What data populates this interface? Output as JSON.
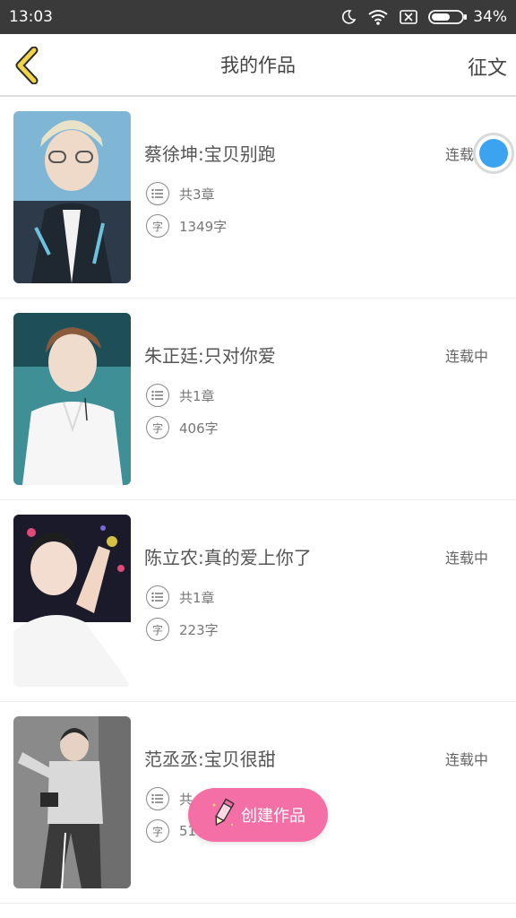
{
  "status_bar": {
    "time": "13:03",
    "battery": "34%"
  },
  "header": {
    "title": "我的作品",
    "action_label": "征文"
  },
  "works": [
    {
      "title": "蔡徐坤:宝贝别跑",
      "status": "连载中",
      "chapters": "共3章",
      "words": "1349字"
    },
    {
      "title": "朱正廷:只对你爱",
      "status": "连载中",
      "chapters": "共1章",
      "words": "406字"
    },
    {
      "title": "陈立农:真的爱上你了",
      "status": "连载中",
      "chapters": "共1章",
      "words": "223字"
    },
    {
      "title": "范丞丞:宝贝很甜",
      "status": "连载中",
      "chapters": "共",
      "words": "51"
    }
  ],
  "meta_icons": {
    "chapters_icon": "list-icon",
    "words_icon": "字"
  },
  "create_button": {
    "label": "创建作品"
  },
  "colors": {
    "accent_pink": "#f46fa6",
    "dot_blue": "#3ba3f0",
    "back_arrow": "#f0d44a"
  }
}
